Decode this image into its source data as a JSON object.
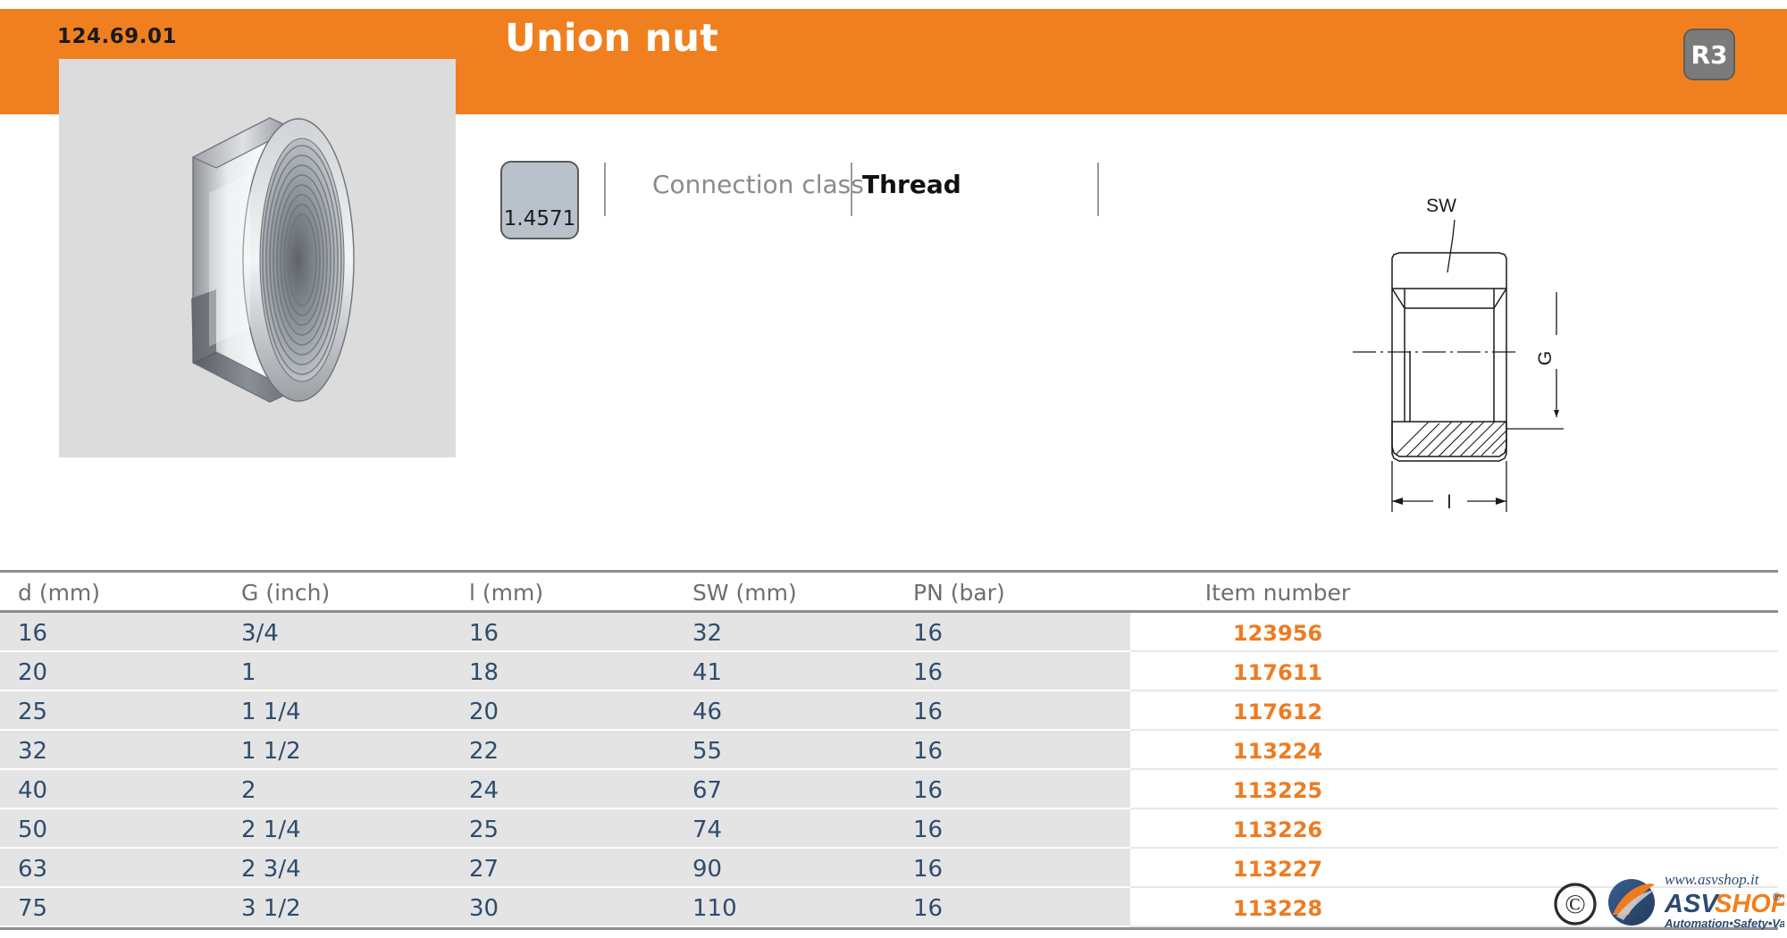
{
  "header": {
    "part_code": "124.69.01",
    "title": "Union nut",
    "rating_badge": "R3",
    "accent_color": "#F0801F"
  },
  "product_image": {
    "alt": "union-nut-photo",
    "background_color": "#DCDCDC"
  },
  "specs": {
    "material_badge": "1.4571",
    "connection_class_label": "Connection class",
    "connection_class_value": "Thread"
  },
  "drawing": {
    "label_sw": "SW",
    "label_g": "G",
    "label_l": "l"
  },
  "table": {
    "columns": [
      "d (mm)",
      "G (inch)",
      "l (mm)",
      "SW (mm)",
      "PN (bar)",
      "Item number"
    ],
    "rows": [
      {
        "d": "16",
        "g": "3/4",
        "l": "16",
        "sw": "32",
        "pn": "16",
        "item": "123956"
      },
      {
        "d": "20",
        "g": "1",
        "l": "18",
        "sw": "41",
        "pn": "16",
        "item": "117611"
      },
      {
        "d": "25",
        "g": "1 1/4",
        "l": "20",
        "sw": "46",
        "pn": "16",
        "item": "117612"
      },
      {
        "d": "32",
        "g": "1 1/2",
        "l": "22",
        "sw": "55",
        "pn": "16",
        "item": "113224"
      },
      {
        "d": "40",
        "g": "2",
        "l": "24",
        "sw": "67",
        "pn": "16",
        "item": "113225"
      },
      {
        "d": "50",
        "g": "2 1/4",
        "l": "25",
        "sw": "74",
        "pn": "16",
        "item": "113226"
      },
      {
        "d": "63",
        "g": "2 3/4",
        "l": "27",
        "sw": "90",
        "pn": "16",
        "item": "113227"
      },
      {
        "d": "75",
        "g": "3 1/2",
        "l": "30",
        "sw": "110",
        "pn": "16",
        "item": "113228"
      }
    ],
    "item_color": "#EE7B21",
    "value_color": "#2E4C6D",
    "row_band_color": "#E4E4E4"
  },
  "logo": {
    "copyright": "©",
    "website": "www.asvshop.it",
    "name_part1": "ASV",
    "name_part2": "SHOP",
    "registered": "®",
    "tagline": "Automation•Safety•Valves",
    "navy": "#2C4A73",
    "orange": "#F08020"
  }
}
